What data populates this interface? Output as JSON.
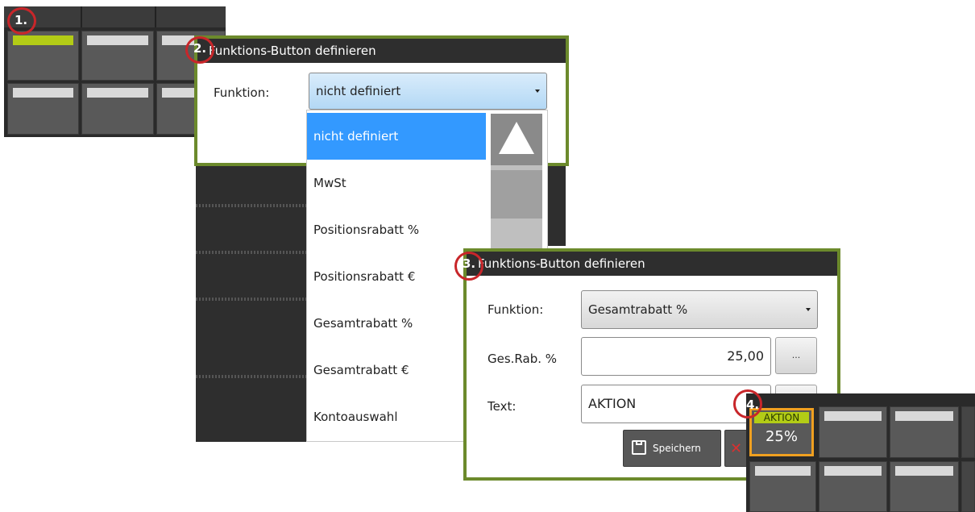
{
  "steps": [
    "1.",
    "2.",
    "3.",
    "4."
  ],
  "dialog_title": "Funktions-Button definieren",
  "panel2": {
    "funktion_label": "Funktion:",
    "selected_value": "nicht definiert",
    "options": [
      "nicht definiert",
      "MwSt",
      "Positionsrabatt %",
      "Positionsrabatt €",
      "Gesamtrabatt %",
      "Gesamtrabatt €",
      "Kontoauswahl"
    ]
  },
  "panel3": {
    "funktion_label": "Funktion:",
    "funktion_value": "Gesamtrabatt %",
    "rabatt_label": "Ges.Rab. %",
    "rabatt_value": "25,00",
    "text_label": "Text:",
    "text_value": "AKTION",
    "dots_label": "...",
    "save_label": "Speichern"
  },
  "panel4": {
    "key_tag": "AKTION",
    "key_value": "25%"
  },
  "colors": {
    "accent_green": "#b3cc16",
    "dialog_border": "#6c8a2c",
    "selection_blue": "#3399ff",
    "highlight_orange": "#f0a020",
    "step_ring_red": "#c8262a"
  }
}
